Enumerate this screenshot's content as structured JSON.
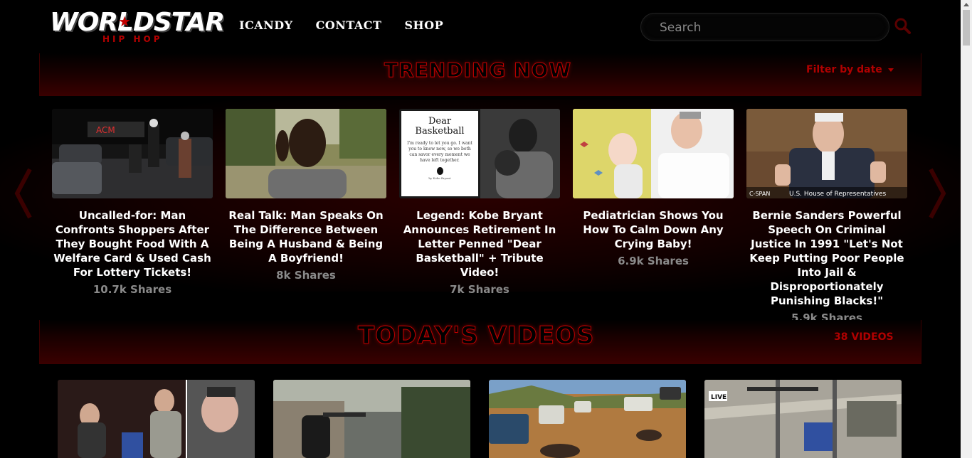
{
  "brand": {
    "name": "WORLDSTAR",
    "sub": "HIP HOP"
  },
  "nav": [
    {
      "label": "ICANDY"
    },
    {
      "label": "CONTACT"
    },
    {
      "label": "SHOP"
    }
  ],
  "search": {
    "placeholder": "Search",
    "value": ""
  },
  "trending": {
    "title": "TRENDING NOW",
    "filter_label": "Filter by date",
    "items": [
      {
        "title": "Uncalled-for: Man Confronts Shoppers After They Bought Food With A Welfare Card & Used Cash For Lottery Tickets!",
        "shares": "10.7k Shares"
      },
      {
        "title": "Real Talk: Man Speaks On The Difference Between Being A Husband & Being A Boyfriend!",
        "shares": "8k Shares"
      },
      {
        "title": "Legend: Kobe Bryant Announces Retirement In Letter Penned \"Dear Basketball\" + Tribute Video!",
        "shares": "7k Shares",
        "thumb_text": {
          "heading": "Dear Basketball",
          "body": "I'm ready to let you go. I want you to know now, so we both can savor every moment we have left together.",
          "sig": "by Kobe Bryant"
        }
      },
      {
        "title": "Pediatrician Shows You How To Calm Down Any Crying Baby!",
        "shares": "6.9k Shares"
      },
      {
        "title": "Bernie Sanders Powerful Speech On Criminal Justice In 1991 \"Let's Not Keep Putting Poor People Into Jail & Disproportionately Punishing Blacks!\"",
        "shares": "5.9k Shares",
        "thumb_text": {
          "network": "C-SPAN",
          "caption": "U.S. House of Representatives"
        }
      }
    ]
  },
  "today": {
    "title": "TODAY'S VIDEOS",
    "count_label": "38 VIDEOS",
    "live_badge": "LIVE"
  },
  "colors": {
    "accent": "#b00000",
    "background": "#000000",
    "shares": "#8a8a8a"
  }
}
